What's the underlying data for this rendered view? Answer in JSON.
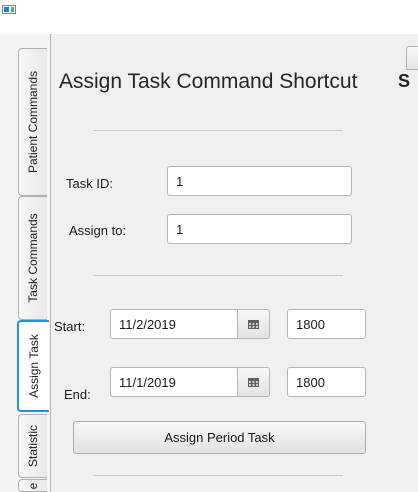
{
  "window": {
    "icon": "app-window-icon"
  },
  "sidebar": {
    "tabs": [
      {
        "label": "Patient Commands",
        "selected": false
      },
      {
        "label": "Task Commands",
        "selected": false
      },
      {
        "label": "Assign Task",
        "selected": true
      },
      {
        "label": "Statistic",
        "selected": false
      },
      {
        "label": "e",
        "selected": false
      }
    ]
  },
  "form": {
    "title": "Assign Task Command Shortcut",
    "task_id_label": "Task ID:",
    "task_id_value": "1",
    "assign_to_label": "Assign to:",
    "assign_to_value": "1",
    "start_label": "Start:",
    "start_date": "11/2/2019",
    "start_time": "1800",
    "end_label": "End:",
    "end_date": "11/1/2019",
    "end_time": "1800",
    "calendar_icon": "calendar-icon",
    "assign_button": "Assign Period Task"
  },
  "right_panel": {
    "partial_letter": "S"
  }
}
